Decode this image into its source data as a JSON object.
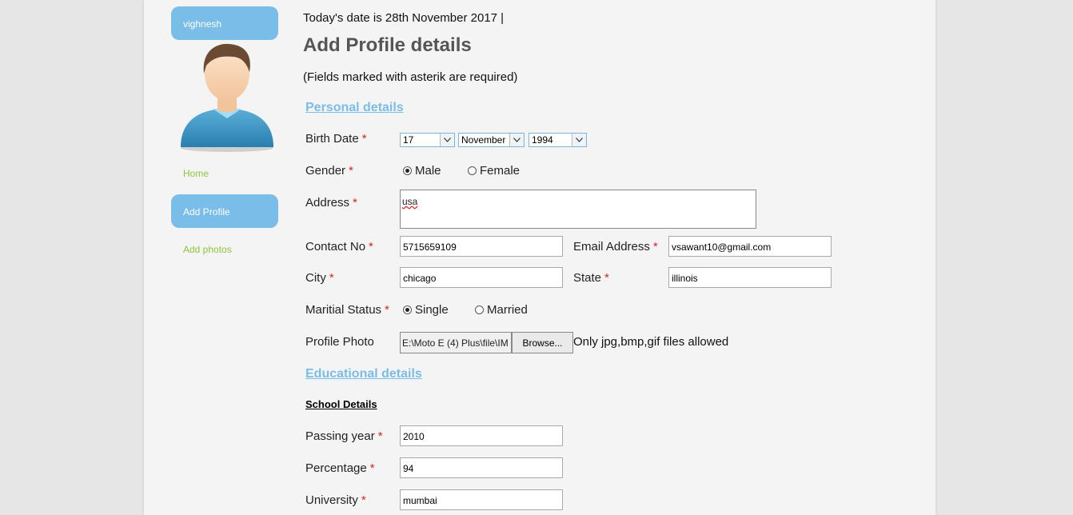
{
  "sidebar": {
    "username": "vighnesh",
    "nav": [
      "Home",
      "Add Profile",
      "Add photos"
    ]
  },
  "header": {
    "date_line": "Today's date is 28th November 2017  |",
    "title": "Add Profile details",
    "required_note": "(Fields marked with asterik are required)"
  },
  "personal": {
    "section_title": "Personal details",
    "birth_date": {
      "label": "Birth Date",
      "day": "17",
      "month": "November",
      "year": "1994"
    },
    "gender": {
      "label": "Gender",
      "options": [
        "Male",
        "Female"
      ],
      "selected": "Male"
    },
    "address": {
      "label": "Address",
      "value": "usa"
    },
    "contact": {
      "label": "Contact No",
      "value": "5715659109"
    },
    "email": {
      "label": "Email Address",
      "value": "vsawant10@gmail.com"
    },
    "city": {
      "label": "City",
      "value": "chicago"
    },
    "state": {
      "label": "State",
      "value": "illinois"
    },
    "marital": {
      "label": "Maritial Status",
      "options": [
        "Single",
        "Married"
      ],
      "selected": "Single"
    },
    "photo": {
      "label": "Profile Photo",
      "path": "E:\\Moto E (4) Plus\\file\\IM",
      "browse": "Browse...",
      "hint": "Only jpg,bmp,gif files allowed"
    }
  },
  "education": {
    "section_title": "Educational details",
    "school_title": "School Details",
    "passing_year": {
      "label": "Passing year",
      "value": "2010"
    },
    "percentage": {
      "label": "Percentage",
      "value": "94"
    },
    "university": {
      "label": "University",
      "value": "mumbai"
    }
  },
  "required_mark": "*",
  "colors": {
    "accent": "#79bde8",
    "link_green": "#8cc63e",
    "required_red": "#dd2222"
  }
}
